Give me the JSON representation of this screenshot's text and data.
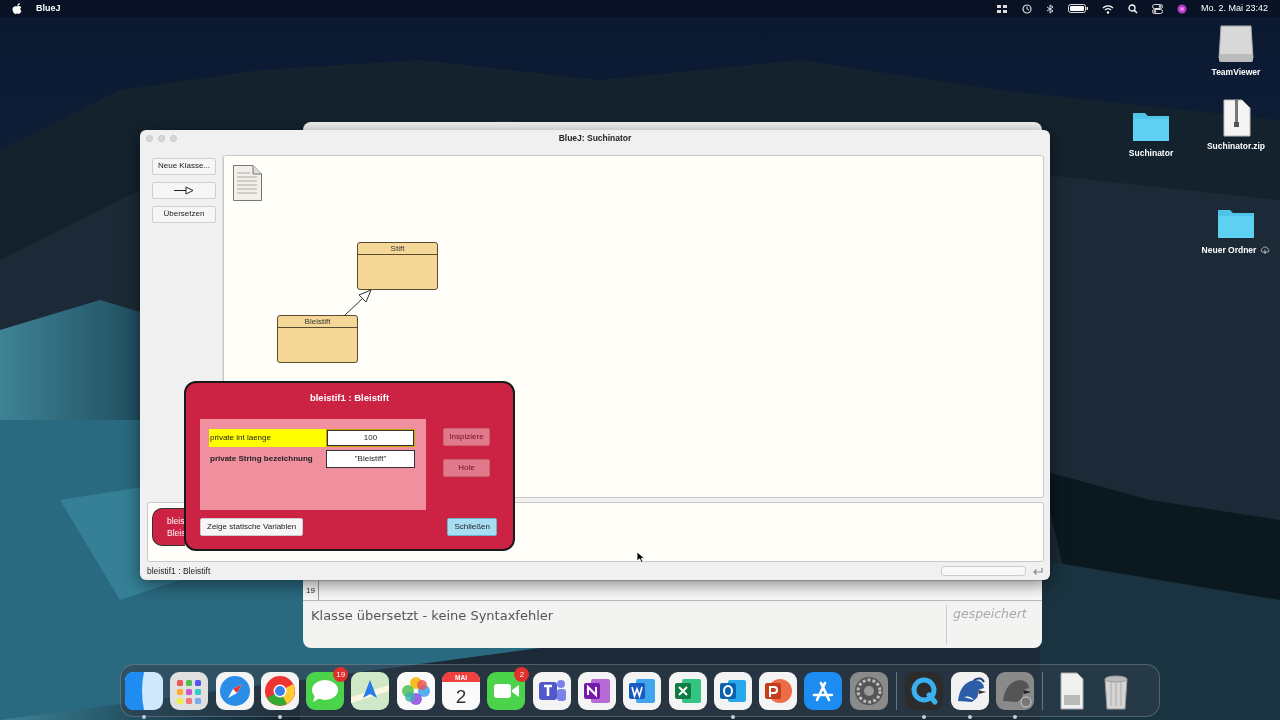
{
  "menu_bar": {
    "app": "BlueJ",
    "clock": "Mo. 2. Mai  23:42"
  },
  "desktop_icons": [
    {
      "label": "TeamViewer",
      "kind": "drive"
    },
    {
      "label": "Suchinator",
      "kind": "folder"
    },
    {
      "label": "Suchinator.zip",
      "kind": "zip"
    },
    {
      "label": "Neuer Ordner",
      "kind": "cloud-folder"
    }
  ],
  "editor_window": {
    "line_number": "19",
    "message": "Klasse übersetzt - keine Syntaxfehler",
    "save_state": "gespeichert"
  },
  "main_window": {
    "title": "BlueJ:  Suchinator",
    "tools": [
      {
        "kind": "text",
        "label": "Neue Klasse..."
      },
      {
        "kind": "arrow"
      },
      {
        "kind": "text",
        "label": "Übersetzen"
      }
    ],
    "classes": [
      {
        "name": "Stift"
      },
      {
        "name": "Bleistift"
      }
    ],
    "object_bench": [
      {
        "line_1": "bleis",
        "line_2": "Bleis"
      }
    ],
    "status": "bleistif1 : Bleistift"
  },
  "inspector": {
    "title": "bleistif1 : Bleistift",
    "fields": [
      {
        "declaration": "private int laenge",
        "value": "100",
        "selected": true
      },
      {
        "declaration": "private String bezeichnung",
        "value": "\"Bleistift\"",
        "selected": false
      }
    ],
    "actions": [
      {
        "label": "Inspiziere",
        "disabled": true
      },
      {
        "label": "Hole",
        "disabled": true
      }
    ],
    "static_button": "Zeige statische Variablen",
    "close_button": "Schließen"
  },
  "dock": [
    {
      "kind": "finder",
      "running": true
    },
    {
      "kind": "launchpad",
      "running": false
    },
    {
      "kind": "safari",
      "running": false
    },
    {
      "kind": "chrome",
      "running": true
    },
    {
      "kind": "messages",
      "running": false,
      "badge": "19"
    },
    {
      "kind": "maps",
      "running": false
    },
    {
      "kind": "photos",
      "running": false
    },
    {
      "kind": "calendar",
      "running": false,
      "month": "MAI",
      "day": "2"
    },
    {
      "kind": "facetime",
      "running": false,
      "badge": "2"
    },
    {
      "kind": "teams",
      "running": false
    },
    {
      "kind": "onenote",
      "running": false
    },
    {
      "kind": "word",
      "running": false
    },
    {
      "kind": "excel",
      "running": false
    },
    {
      "kind": "outlook",
      "running": true
    },
    {
      "kind": "powerpoint",
      "running": false
    },
    {
      "kind": "appstore",
      "running": false
    },
    {
      "kind": "settings",
      "running": false
    },
    {
      "kind": "separator"
    },
    {
      "kind": "quicktime",
      "running": true
    },
    {
      "kind": "bluej",
      "running": true
    },
    {
      "kind": "bluej-gray",
      "running": true
    },
    {
      "kind": "separator"
    },
    {
      "kind": "document",
      "running": false
    },
    {
      "kind": "trash",
      "running": false
    }
  ]
}
